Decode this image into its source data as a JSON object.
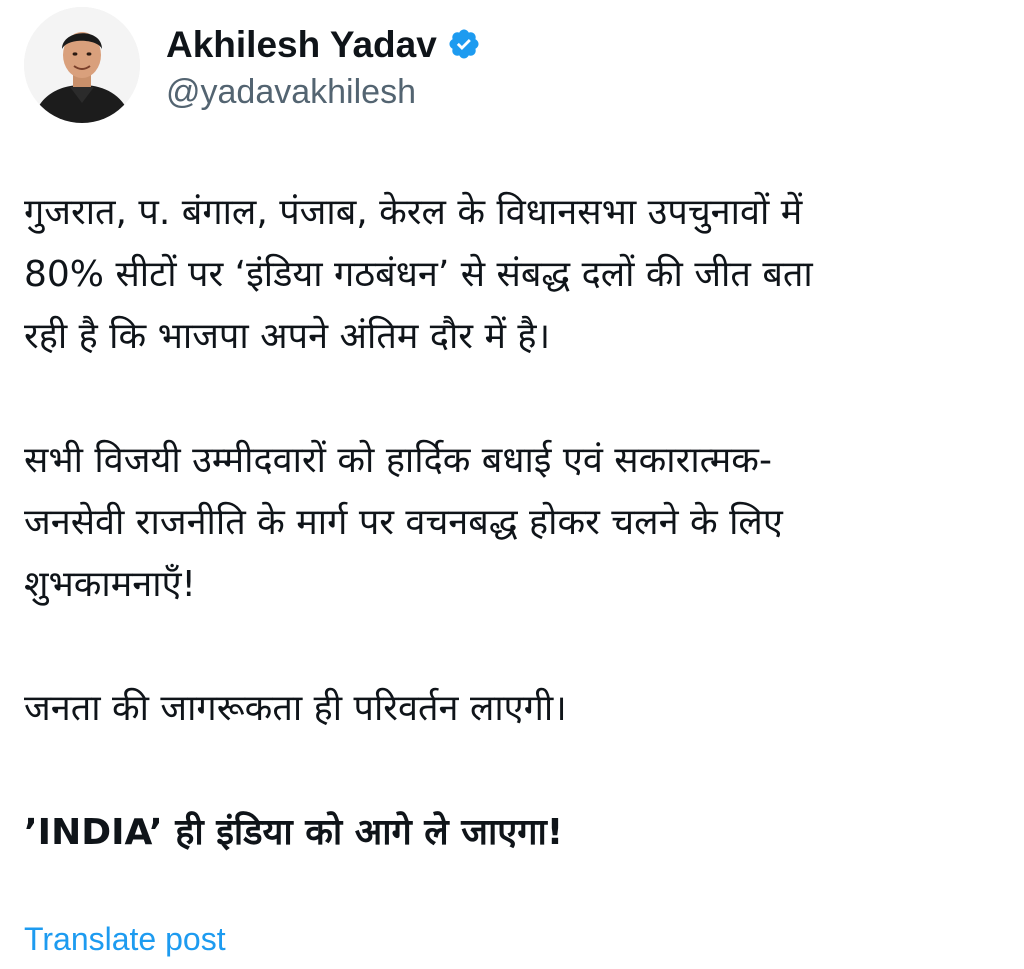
{
  "author": {
    "display_name": "Akhilesh Yadav",
    "handle": "@yadavakhilesh",
    "verified": true,
    "avatar_icon": "profile-photo",
    "verified_icon": "verified-badge-icon",
    "verified_color": "#1d9bf0"
  },
  "post": {
    "paragraphs": [
      "गुजरात, प. बंगाल, पंजाब, केरल के विधानसभा उपचुनावों में\n80% सीटों पर ‘इंडिया गठबंधन’ से संबद्ध दलों की जीत बता\nरही है कि भाजपा अपने अंतिम दौर में है।",
      "सभी विजयी उम्मीदवारों को हार्दिक बधाई एवं सकारात्मक-\nजनसेवी राजनीति के मार्ग पर वचनबद्ध होकर चलने के लिए\nशुभकामनाएँ!",
      "जनता की जागरूकता ही परिवर्तन लाएगी।",
      "’INDIA’ ही इंडिया को आगे ले जाएगा!"
    ]
  },
  "actions": {
    "translate_label": "Translate post",
    "link_color": "#1d9bf0"
  }
}
